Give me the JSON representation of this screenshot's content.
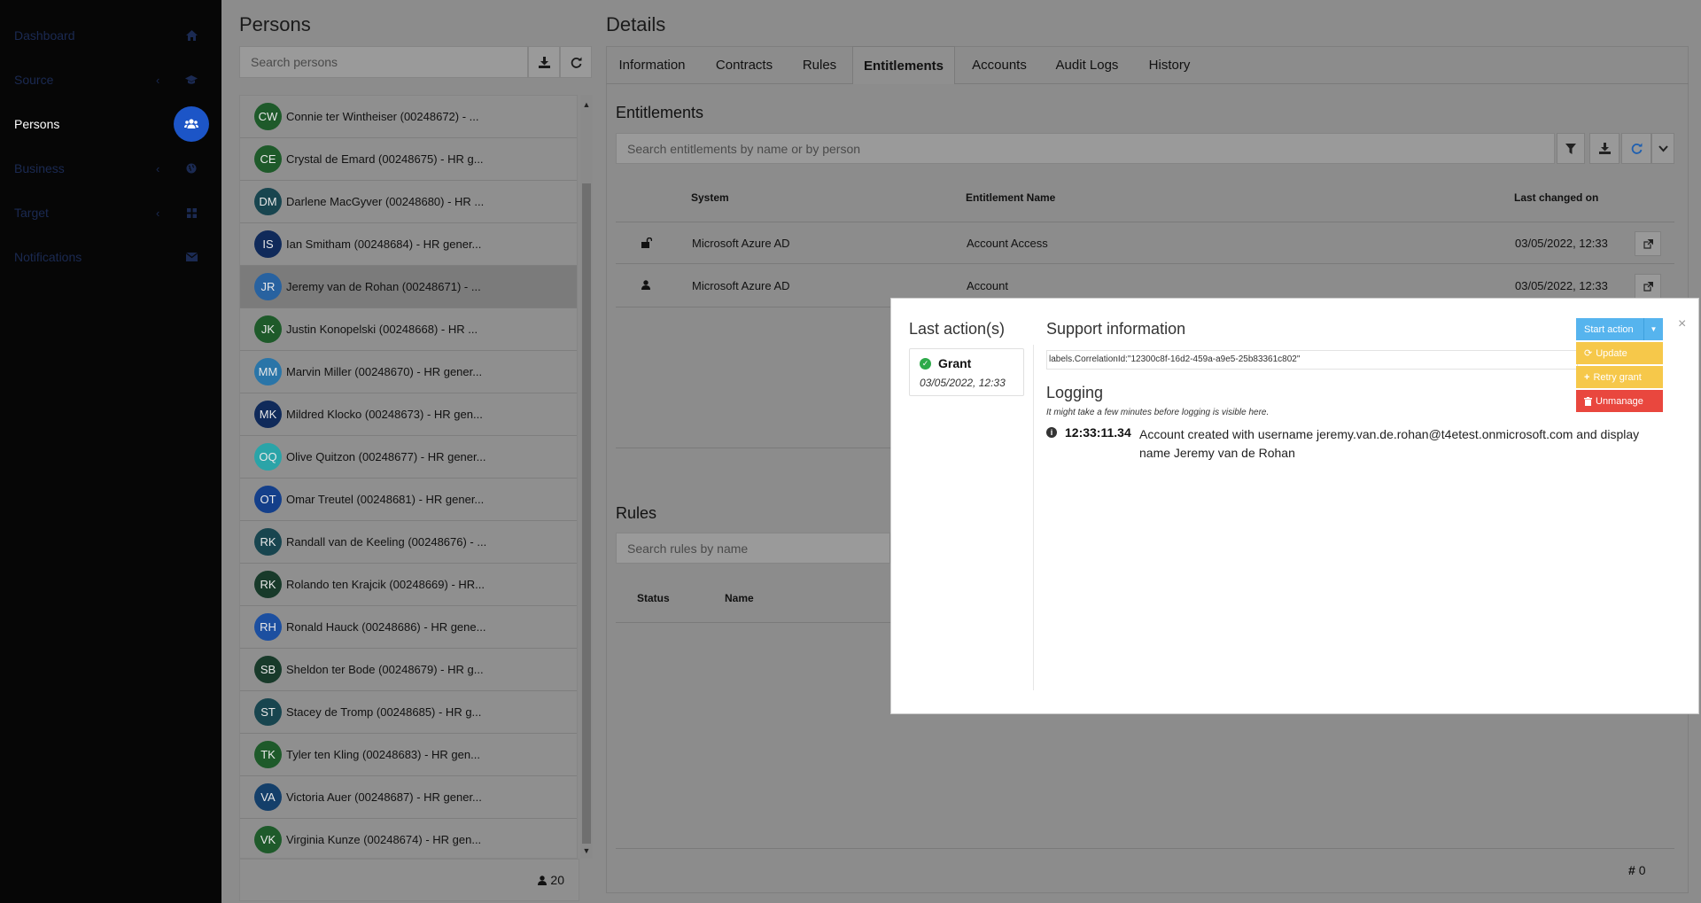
{
  "sidebar": {
    "items": [
      {
        "label": "Dashboard",
        "icon": "home-icon"
      },
      {
        "label": "Source",
        "icon": "graduation-cap-icon",
        "has_chevron": true
      },
      {
        "label": "Persons",
        "icon": "users-icon",
        "active": true
      },
      {
        "label": "Business",
        "icon": "globe-icon",
        "has_chevron": true
      },
      {
        "label": "Target",
        "icon": "grid-icon",
        "has_chevron": true
      },
      {
        "label": "Notifications",
        "icon": "envelope-icon"
      }
    ]
  },
  "persons": {
    "title": "Persons",
    "search_placeholder": "Search persons",
    "count": "20",
    "list": [
      {
        "initials": "CW",
        "name": "Connie ter Wintheiser (00248672) - ...",
        "color": "#1e5a2a"
      },
      {
        "initials": "CE",
        "name": "Crystal de Emard (00248675) - HR g...",
        "color": "#1e5a2a"
      },
      {
        "initials": "DM",
        "name": "Darlene MacGyver (00248680) - HR ...",
        "color": "#18454f"
      },
      {
        "initials": "IS",
        "name": "Ian Smitham (00248684) - HR gener...",
        "color": "#102a5a"
      },
      {
        "initials": "JR",
        "name": "Jeremy van de Rohan (00248671) - ...",
        "color": "#2862a0",
        "selected": true
      },
      {
        "initials": "JK",
        "name": "Justin Konopelski (00248668) - HR ...",
        "color": "#1e5a2a"
      },
      {
        "initials": "MM",
        "name": "Marvin Miller (00248670) - HR gener...",
        "color": "#2a75a8"
      },
      {
        "initials": "MK",
        "name": "Mildred Klocko (00248673) - HR gen...",
        "color": "#102a5a"
      },
      {
        "initials": "OQ",
        "name": "Olive Quitzon (00248677) - HR gener...",
        "color": "#2aa4a8"
      },
      {
        "initials": "OT",
        "name": "Omar Treutel (00248681) - HR gener...",
        "color": "#143f8a"
      },
      {
        "initials": "RK",
        "name": "Randall van de Keeling (00248676) - ...",
        "color": "#18454f"
      },
      {
        "initials": "RK",
        "name": "Rolando ten Krajcik (00248669) - HR...",
        "color": "#183a2a"
      },
      {
        "initials": "RH",
        "name": "Ronald Hauck (00248686) - HR gene...",
        "color": "#1c4fa0"
      },
      {
        "initials": "SB",
        "name": "Sheldon ter Bode (00248679) - HR g...",
        "color": "#183a2a"
      },
      {
        "initials": "ST",
        "name": "Stacey de Tromp (00248685) - HR g...",
        "color": "#18454f"
      },
      {
        "initials": "TK",
        "name": "Tyler ten Kling (00248683) - HR gen...",
        "color": "#1e5a2a"
      },
      {
        "initials": "VA",
        "name": "Victoria Auer (00248687) - HR gener...",
        "color": "#143f6a"
      },
      {
        "initials": "VK",
        "name": "Virginia Kunze (00248674) - HR gen...",
        "color": "#1e5a2a"
      }
    ]
  },
  "details": {
    "title": "Details",
    "tabs": [
      "Information",
      "Contracts",
      "Rules",
      "Entitlements",
      "Accounts",
      "Audit Logs",
      "History"
    ],
    "active_tab": "Entitlements",
    "entitlements": {
      "title": "Entitlements",
      "search_placeholder": "Search entitlements by name or by person",
      "columns": [
        "System",
        "Entitlement Name",
        "Last changed on"
      ],
      "rows": [
        {
          "icon": "unlock-icon",
          "system": "Microsoft Azure AD",
          "name": "Account Access",
          "changed": "03/05/2022, 12:33"
        },
        {
          "icon": "user-icon",
          "system": "Microsoft Azure AD",
          "name": "Account",
          "changed": "03/05/2022, 12:33"
        }
      ]
    },
    "rules": {
      "title": "Rules",
      "search_placeholder": "Search rules by name",
      "columns": [
        "Status",
        "Name"
      ]
    },
    "footer_count": "0"
  },
  "modal": {
    "last_actions_title": "Last action(s)",
    "grant": {
      "label": "Grant",
      "date": "03/05/2022, 12:33"
    },
    "support_title": "Support information",
    "correlation": "labels.CorrelationId:\"12300c8f-16d2-459a-a9e5-25b83361c802\"",
    "logging_title": "Logging",
    "logging_hint": "It might take a few minutes before logging is visible here.",
    "log_time": "12:33:11.34",
    "log_message": "Account created with username jeremy.van.de.rohan@t4etest.onmicrosoft.com and display name Jeremy van de Rohan",
    "buttons": {
      "start": "Start action",
      "update": "Update",
      "retry": "Retry grant",
      "unmanage": "Unmanage"
    },
    "colors": {
      "start": "#56b4ee",
      "update": "#f6c84a",
      "retry": "#f6c84a",
      "unmanage": "#e9473e",
      "grant_ok": "#2eaa4a"
    }
  }
}
